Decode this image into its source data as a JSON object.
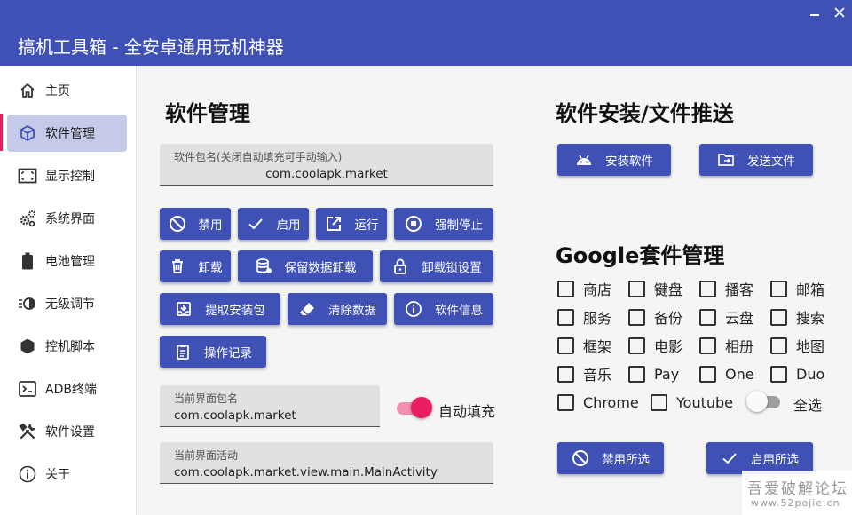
{
  "window": {
    "title": "搞机工具箱 - 全安卓通用玩机神器"
  },
  "sidebar": {
    "items": [
      {
        "label": "主页",
        "icon": "home-icon"
      },
      {
        "label": "软件管理",
        "icon": "cube-icon",
        "active": true
      },
      {
        "label": "显示控制",
        "icon": "screen-frame-icon"
      },
      {
        "label": "系统界面",
        "icon": "gears-icon"
      },
      {
        "label": "电池管理",
        "icon": "battery-icon"
      },
      {
        "label": "无级调节",
        "icon": "brightness-icon"
      },
      {
        "label": "控机脚本",
        "icon": "hexagon-icon"
      },
      {
        "label": "ADB终端",
        "icon": "terminal-icon"
      },
      {
        "label": "软件设置",
        "icon": "tools-icon"
      },
      {
        "label": "关于",
        "icon": "info-icon"
      }
    ]
  },
  "software": {
    "title": "软件管理",
    "package_field": {
      "label": "软件包名(关闭自动填充可手动输入)",
      "value": "com.coolapk.market"
    },
    "buttons": {
      "disable": "禁用",
      "enable": "启用",
      "run": "运行",
      "force_stop": "强制停止",
      "uninstall": "卸载",
      "keep_data_uninstall": "保留数据卸载",
      "uninstall_lock": "卸载锁设置",
      "extract_apk": "提取安装包",
      "clear_data": "清除数据",
      "app_info": "软件信息",
      "op_log": "操作记录"
    },
    "current_package": {
      "label": "当前界面包名",
      "value": "com.coolapk.market"
    },
    "autofill": {
      "label": "自动填充",
      "on": true
    },
    "current_activity": {
      "label": "当前界面活动",
      "value": "com.coolapk.market.view.main.MainActivity"
    }
  },
  "install": {
    "title": "软件安装/文件推送",
    "install_btn": "安装软件",
    "push_btn": "发送文件"
  },
  "google": {
    "title": "Google套件管理",
    "checkboxes": [
      [
        "商店",
        "键盘",
        "播客",
        "邮箱"
      ],
      [
        "服务",
        "备份",
        "云盘",
        "搜索"
      ],
      [
        "框架",
        "电影",
        "相册",
        "地图"
      ],
      [
        "音乐",
        "Pay",
        "One",
        "Duo"
      ]
    ],
    "last_row": {
      "chrome": "Chrome",
      "youtube": "Youtube",
      "select_all": "全选",
      "select_all_on": false
    },
    "disable_selected": "禁用所选",
    "enable_selected": "启用所选"
  },
  "watermark": {
    "line1": "吾爱破解论坛",
    "line2": "www.52pojie.cn"
  },
  "colors": {
    "primary": "#3f51b5",
    "accent": "#e91e63",
    "selected_nav": "#c5cae9",
    "background": "#f5f5f5"
  }
}
